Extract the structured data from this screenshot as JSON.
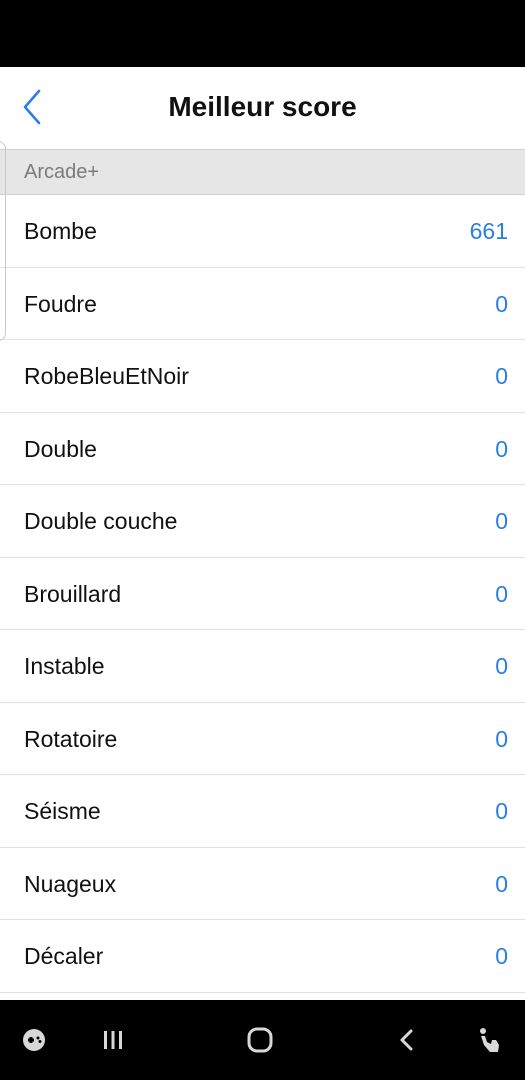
{
  "header": {
    "title": "Meilleur score",
    "back_icon": "chevron-left-icon"
  },
  "section": {
    "label": "Arcade+"
  },
  "scores": [
    {
      "mode": "Bombe",
      "score": "661"
    },
    {
      "mode": "Foudre",
      "score": "0"
    },
    {
      "mode": "RobeBleuEtNoir",
      "score": "0"
    },
    {
      "mode": "Double",
      "score": "0"
    },
    {
      "mode": "Double couche",
      "score": "0"
    },
    {
      "mode": "Brouillard",
      "score": "0"
    },
    {
      "mode": "Instable",
      "score": "0"
    },
    {
      "mode": "Rotatoire",
      "score": "0"
    },
    {
      "mode": "Séisme",
      "score": "0"
    },
    {
      "mode": "Nuageux",
      "score": "0"
    },
    {
      "mode": "Décaler",
      "score": "0"
    }
  ],
  "nav_bar": {
    "icons": [
      "game-launcher-icon",
      "recent-apps-icon",
      "home-icon",
      "back-icon",
      "accessibility-icon"
    ]
  },
  "colors": {
    "accent": "#2a7fe0",
    "section_background": "#e6e6e6",
    "system_bars": "#000000"
  }
}
